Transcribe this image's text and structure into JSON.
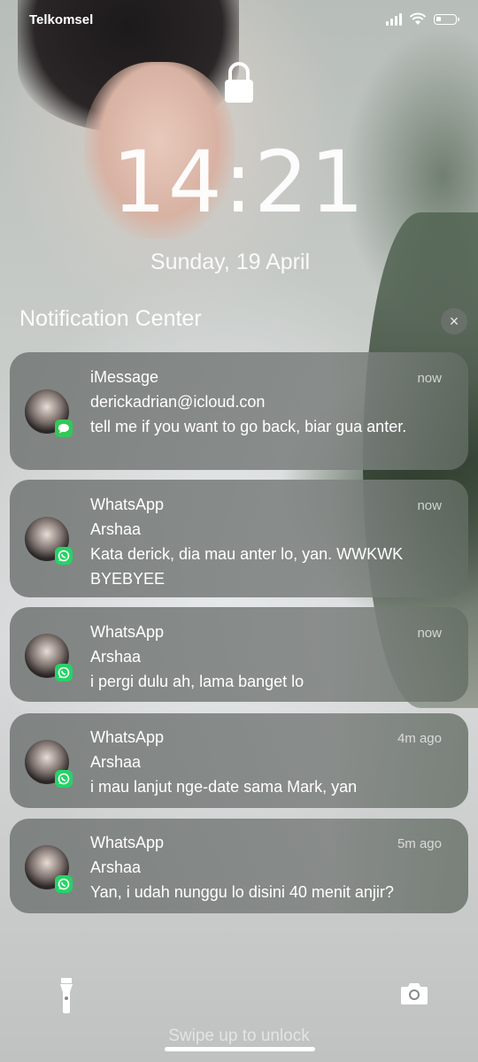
{
  "status_bar": {
    "carrier": "Telkomsel"
  },
  "lock_screen": {
    "time": "14:21",
    "date": "Sunday, 19 April"
  },
  "notification_center": {
    "title": "Notification Center",
    "close_glyph": "×",
    "notifications": [
      {
        "app": "iMessage",
        "time": "now",
        "sender": "derickadrian@icloud.con",
        "message": "tell me if you want to go back, biar gua anter."
      },
      {
        "app": "WhatsApp",
        "time": "now",
        "sender": "Arshaa",
        "message": "Kata derick, dia mau anter lo, yan. WWKWK BYEBYEE"
      },
      {
        "app": "WhatsApp",
        "time": "now",
        "sender": "Arshaa",
        "message": "i pergi dulu ah, lama banget lo"
      },
      {
        "app": "WhatsApp",
        "time": "4m ago",
        "sender": "Arshaa",
        "message": "i mau lanjut nge-date sama Mark, yan"
      },
      {
        "app": "WhatsApp",
        "time": "5m ago",
        "sender": "Arshaa",
        "message": "Yan, i udah nunggu lo disini 40 menit anjir?"
      }
    ]
  },
  "bottom": {
    "swipe_hint": "Swipe up to unlock"
  },
  "icons": {
    "lock": "lock-icon",
    "flashlight": "flashlight-icon",
    "camera": "camera-icon",
    "imessage_badge": "imessage-icon",
    "whatsapp_badge": "whatsapp-icon"
  },
  "colors": {
    "imessage": "#34c759",
    "whatsapp": "#25d366"
  }
}
